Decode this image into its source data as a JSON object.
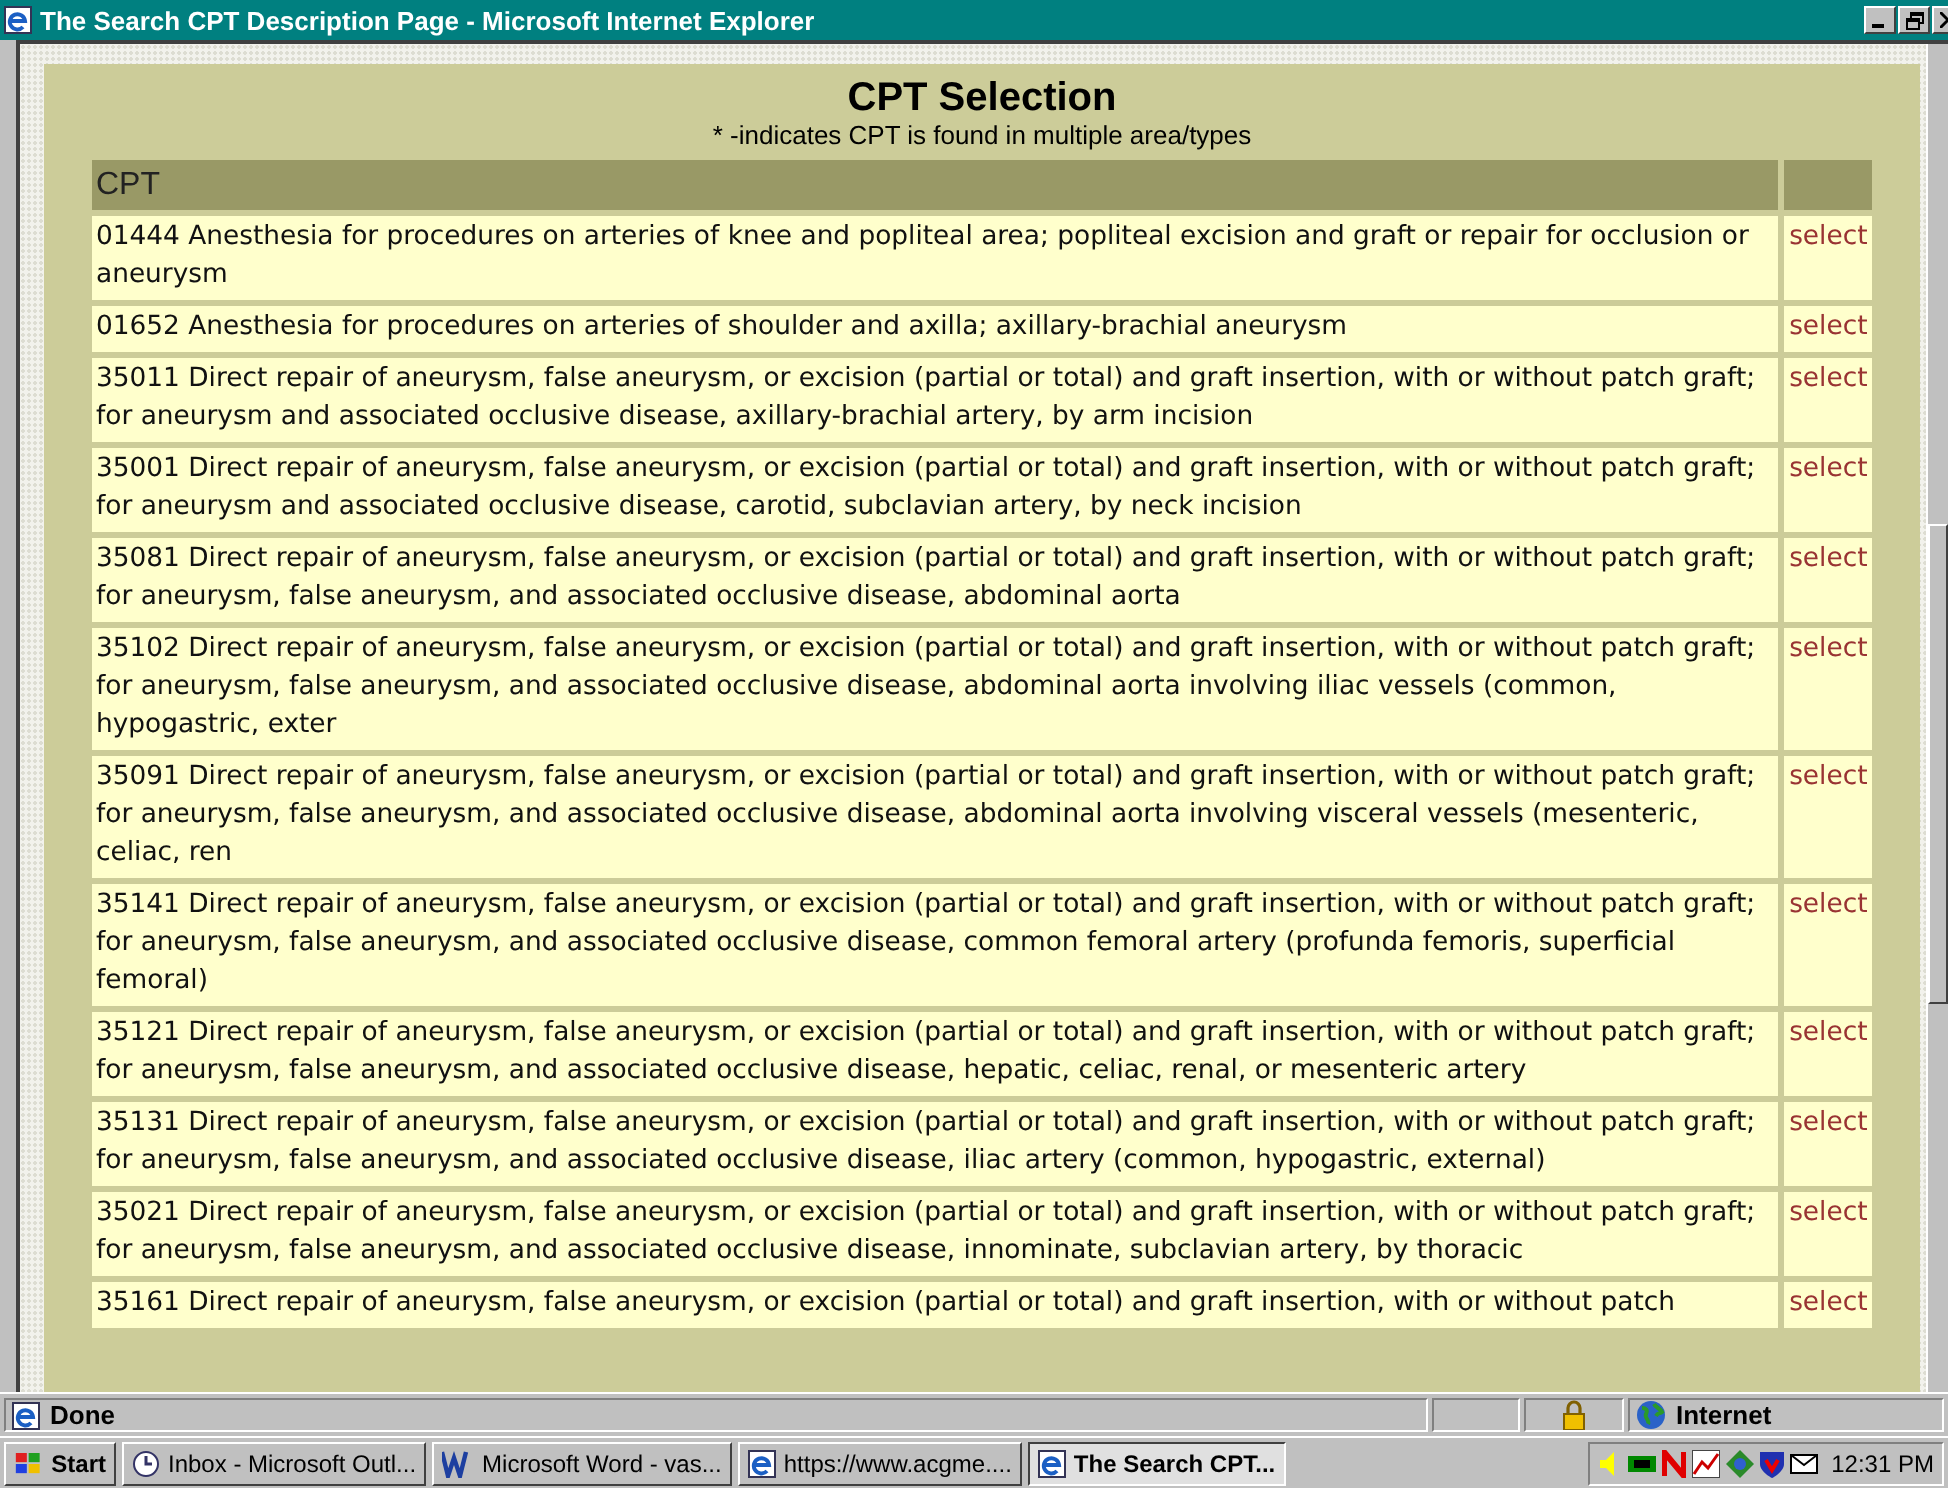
{
  "window": {
    "title": "The Search CPT Description Page - Microsoft Internet Explorer"
  },
  "page": {
    "heading": "CPT Selection",
    "note": "* -indicates CPT is found in multiple area/types",
    "table": {
      "columns": [
        "CPT"
      ],
      "rows": [
        {
          "description": "01444 Anesthesia for procedures on arteries of knee and popliteal area; popliteal excision and graft or repair for occlusion or aneurysm",
          "action": "select"
        },
        {
          "description": "01652 Anesthesia for procedures on arteries of shoulder and axilla; axillary-brachial aneurysm",
          "action": "select"
        },
        {
          "description": "35011 Direct repair of aneurysm, false aneurysm, or excision (partial or total) and graft insertion, with or without patch graft; for aneurysm and associated occlusive disease, axillary-brachial artery, by arm incision",
          "action": "select"
        },
        {
          "description": "35001 Direct repair of aneurysm, false aneurysm, or excision (partial or total) and graft insertion, with or without patch graft; for aneurysm and associated occlusive disease, carotid, subclavian artery, by neck incision",
          "action": "select"
        },
        {
          "description": "35081 Direct repair of aneurysm, false aneurysm, or excision (partial or total) and graft insertion, with or without patch graft; for aneurysm, false aneurysm, and associated occlusive disease, abdominal aorta",
          "action": "select"
        },
        {
          "description": "35102 Direct repair of aneurysm, false aneurysm, or excision (partial or total) and graft insertion, with or without patch graft; for aneurysm, false aneurysm, and associated occlusive disease, abdominal aorta involving iliac vessels (common, hypogastric, exter",
          "action": "select"
        },
        {
          "description": "35091 Direct repair of aneurysm, false aneurysm, or excision (partial or total) and graft insertion, with or without patch graft; for aneurysm, false aneurysm, and associated occlusive disease, abdominal aorta involving visceral vessels (mesenteric, celiac, ren",
          "action": "select"
        },
        {
          "description": "35141 Direct repair of aneurysm, false aneurysm, or excision (partial or total) and graft insertion, with or without patch graft; for aneurysm, false aneurysm, and associated occlusive disease, common femoral artery (profunda femoris, superficial femoral)",
          "action": "select"
        },
        {
          "description": "35121 Direct repair of aneurysm, false aneurysm, or excision (partial or total) and graft insertion, with or without patch graft; for aneurysm, false aneurysm, and associated occlusive disease, hepatic, celiac, renal, or mesenteric artery",
          "action": "select"
        },
        {
          "description": "35131 Direct repair of aneurysm, false aneurysm, or excision (partial or total) and graft insertion, with or without patch graft; for aneurysm, false aneurysm, and associated occlusive disease, iliac artery (common, hypogastric, external)",
          "action": "select"
        },
        {
          "description": "35021 Direct repair of aneurysm, false aneurysm, or excision (partial or total) and graft insertion, with or without patch graft; for aneurysm, false aneurysm, and associated occlusive disease, innominate, subclavian artery, by thoracic",
          "action": "select"
        },
        {
          "description": "35161 Direct repair of aneurysm, false aneurysm, or excision (partial or total) and graft insertion, with or without patch",
          "action": "select"
        }
      ]
    }
  },
  "status_bar": {
    "text": "Done",
    "zone": "Internet"
  },
  "taskbar": {
    "start": "Start",
    "tasks": [
      {
        "label": "Inbox - Microsoft Outl...",
        "kind": "mail",
        "selected": false
      },
      {
        "label": "Microsoft Word - vas...",
        "kind": "word",
        "selected": false
      },
      {
        "label": "https://www.acgme....",
        "kind": "browser",
        "selected": false
      },
      {
        "label": "The Search CPT...",
        "kind": "browser",
        "selected": true
      }
    ],
    "clock": "12:31 PM"
  }
}
